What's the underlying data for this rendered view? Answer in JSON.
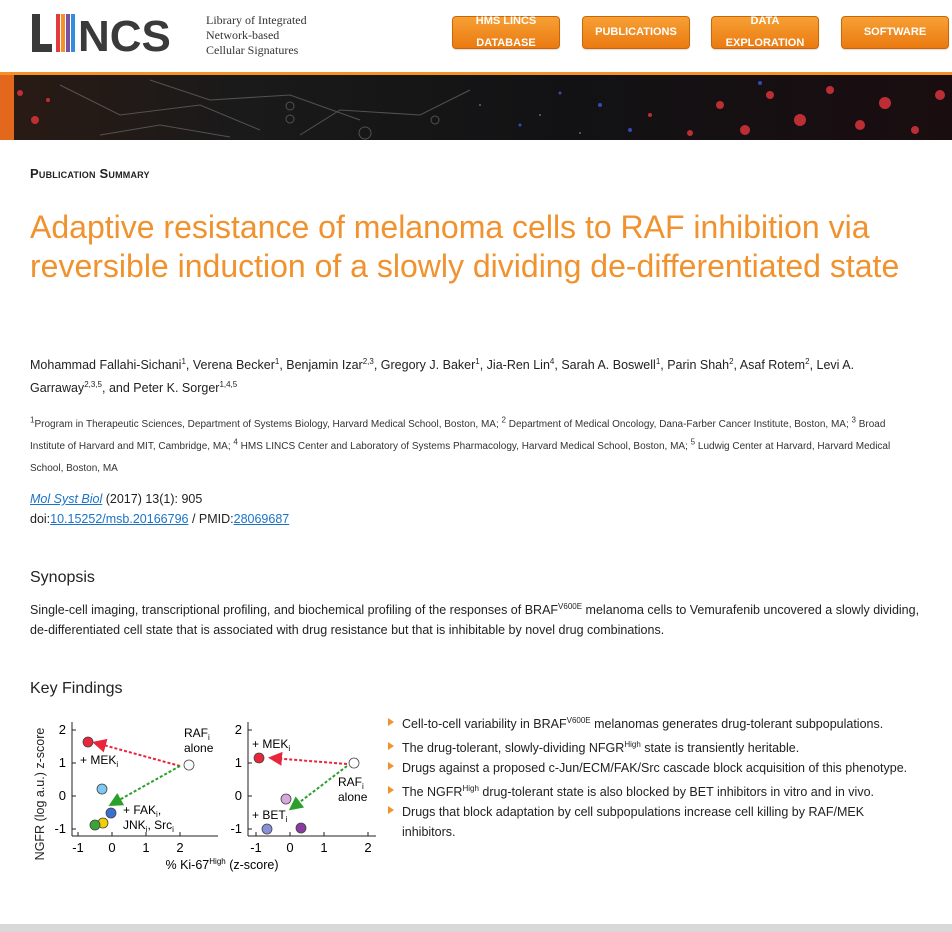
{
  "header": {
    "logo_text": "LINCS",
    "tagline": [
      "Library of Integrated",
      "Network-based",
      "Cellular Signatures"
    ],
    "nav": [
      {
        "line1": "HMS LINCS",
        "line2": "DATABASE"
      },
      {
        "line1": "PUBLICATIONS",
        "line2": ""
      },
      {
        "line1": "DATA",
        "line2": "EXPLORATION"
      },
      {
        "line1": "SOFTWARE",
        "line2": ""
      }
    ],
    "accent_color": "#f0922d"
  },
  "page": {
    "section_label": "Publication Summary",
    "title": "Adaptive resistance of melanoma cells to RAF inhibition via reversible induction of a slowly dividing de-differentiated state",
    "authors": [
      {
        "name": "Mohammad Fallahi-Sichani",
        "sup": "1"
      },
      {
        "name": "Verena Becker",
        "sup": "1"
      },
      {
        "name": "Benjamin Izar",
        "sup": "2,3"
      },
      {
        "name": "Gregory J. Baker",
        "sup": "1"
      },
      {
        "name": "Jia-Ren Lin",
        "sup": "4"
      },
      {
        "name": "Sarah A. Boswell",
        "sup": "1"
      },
      {
        "name": "Parin Shah",
        "sup": "2"
      },
      {
        "name": "Asaf Rotem",
        "sup": "2"
      },
      {
        "name": "Levi A. Garraway",
        "sup": "2,3,5"
      },
      {
        "name": "Peter K. Sorger",
        "sup": "1,4,5"
      }
    ],
    "authors_and": "and",
    "affiliations": [
      {
        "sup": "1",
        "text": "Program in Therapeutic Sciences, Department of Systems Biology, Harvard Medical School, Boston, MA;"
      },
      {
        "sup": "2",
        "text": "Department of Medical Oncology, Dana-Farber Cancer Institute, Boston, MA;"
      },
      {
        "sup": "3",
        "text": "Broad Institute of Harvard and MIT, Cambridge, MA;"
      },
      {
        "sup": "4",
        "text": "HMS LINCS Center and Laboratory of Systems Pharmacology, Harvard Medical School, Boston, MA;"
      },
      {
        "sup": "5",
        "text": "Ludwig Center at Harvard, Harvard Medical School, Boston, MA"
      }
    ],
    "citation": {
      "journal": "Mol Syst Biol",
      "details": "(2017) 13(1): 905",
      "doi_label": "doi:",
      "doi": "10.15252/msb.20166796",
      "pmid_label": "/ PMID:",
      "pmid": "28069687"
    },
    "synopsis_heading": "Synopsis",
    "synopsis": {
      "before": "Single-cell imaging, transcriptional profiling, and biochemical profiling of the responses of BRAF",
      "sup": "V600E",
      "after": " melanoma cells to Vemurafenib uncovered a slowly dividing, de-differentiated cell state that is associated with drug resistance but that is inhibitable by novel drug combinations."
    },
    "key_findings_heading": "Key Findings",
    "findings": [
      {
        "before": "Cell-to-cell variability in BRAF",
        "sup": "V600E",
        "after": " melanomas generates drug-tolerant subpopulations."
      },
      {
        "before": "The drug-tolerant, slowly-dividing NFGR",
        "sup": "High",
        "after": " state is transiently heritable."
      },
      {
        "before": "Drugs against a proposed c-Jun/ECM/FAK/Src cascade block acquisition of this phenotype.",
        "sup": "",
        "after": ""
      },
      {
        "before": "The NGFR",
        "sup": "High",
        "after": " drug-tolerant state is also blocked by BET inhibitors in vitro and in vivo."
      },
      {
        "before": "Drugs that block adaptation by cell subpopulations increase cell killing by RAF/MEK inhibitors.",
        "sup": "",
        "after": ""
      }
    ],
    "figure": {
      "ylabel": "NGFR (log a.u.) z-score",
      "xlabel_main": "% Ki-67",
      "xlabel_sup": "High",
      "xlabel_end": " (z-score)",
      "yticks": [
        "2",
        "1",
        "0",
        "-1"
      ],
      "xticks_left": [
        "-1",
        "0",
        "1",
        "2"
      ],
      "xticks_right": [
        "-1",
        "0",
        "1",
        "2"
      ],
      "left_labels": {
        "raf": "RAF",
        "raf_sub": "i",
        "alone": "alone",
        "mek": "+ MEK",
        "mek_sub": "i",
        "fak": "+ FAK",
        "fak_sub": "i",
        "fak_comma": ",",
        "jnk": "JNK",
        "jnk_sub": "i",
        "src": ", Src",
        "src_sub": "i"
      },
      "right_labels": {
        "mek": "+ MEK",
        "mek_sub": "i",
        "raf": "RAF",
        "raf_sub": "i",
        "alone": "alone",
        "bet": "+ BET",
        "bet_sub": "i"
      }
    }
  }
}
